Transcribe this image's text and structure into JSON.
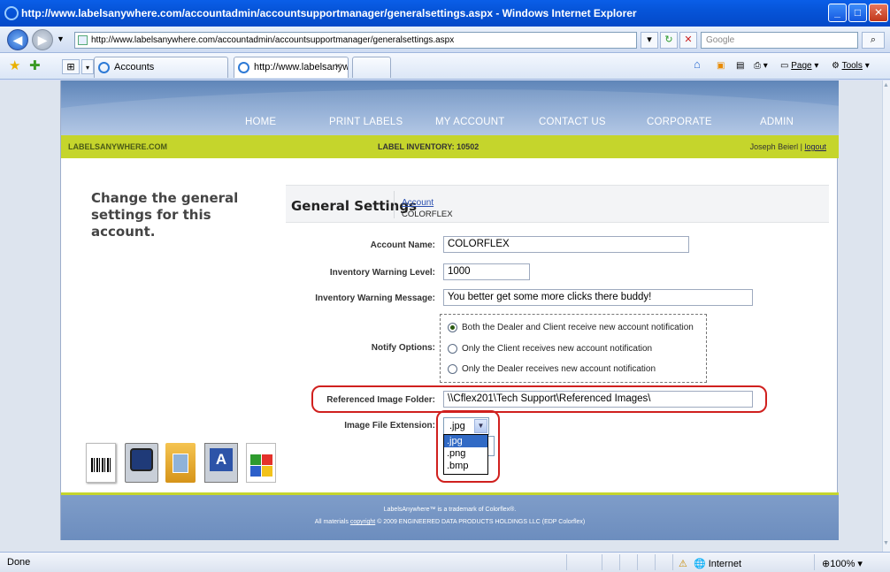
{
  "window": {
    "title": "http://www.labelsanywhere.com/accountadmin/accountsupportmanager/generalsettings.aspx - Windows Internet Explorer"
  },
  "addressbar": {
    "url": "http://www.labelsanywhere.com/accountadmin/accountsupportmanager/generalsettings.aspx",
    "search_placeholder": "Google"
  },
  "tabs": [
    {
      "label": "Accounts"
    },
    {
      "label": "http://www.labelsanywh...",
      "close": "✕"
    }
  ],
  "toolbar": {
    "page_label": "Page",
    "tools_label": "Tools"
  },
  "site": {
    "menu": [
      "HOME",
      "PRINT LABELS",
      "MY ACCOUNT",
      "CONTACT US",
      "CORPORATE",
      "ADMIN"
    ],
    "brand": "LABELSANYWHERE.COM",
    "inventory": "LABEL INVENTORY: 10502",
    "user": "Joseph Beierl |",
    "logout": "logout"
  },
  "intro": "Change the general settings for this account.",
  "panel": {
    "title": "General Settings",
    "crumb_link": "Account",
    "crumb_sub": "COLORFLEX"
  },
  "form": {
    "account_name_label": "Account Name:",
    "account_name_value": "COLORFLEX",
    "warning_level_label": "Inventory Warning Level:",
    "warning_level_value": "1000",
    "warning_message_label": "Inventory Warning Message:",
    "warning_message_value": "You better get some more clicks there buddy!",
    "notify_label": "Notify Options:",
    "notify_options": [
      {
        "label": "Both the Dealer and Client receive new account notification",
        "selected": true
      },
      {
        "label": "Only the Client receives new account notification",
        "selected": false
      },
      {
        "label": "Only the Dealer receives new account notification",
        "selected": false
      }
    ],
    "ref_folder_label": "Referenced Image Folder:",
    "ref_folder_value": "\\\\Cflex201\\Tech Support\\Referenced Images\\",
    "ext_label": "Image File Extension:",
    "ext_selected": ".jpg",
    "ext_options": [
      ".jpg",
      ".png",
      ".bmp"
    ]
  },
  "footer": {
    "line1": "LabelsAnywhere™ is a trademark of Colorflex®.",
    "line2_pre": "All materials",
    "line2_link": "copyright",
    "line2_post": "© 2009 ENGINEERED DATA PRODUCTS HOLDINGS LLC (EDP Colorflex)"
  },
  "statusbar": {
    "status": "Done",
    "zone": "Internet",
    "zoom": "100%"
  }
}
